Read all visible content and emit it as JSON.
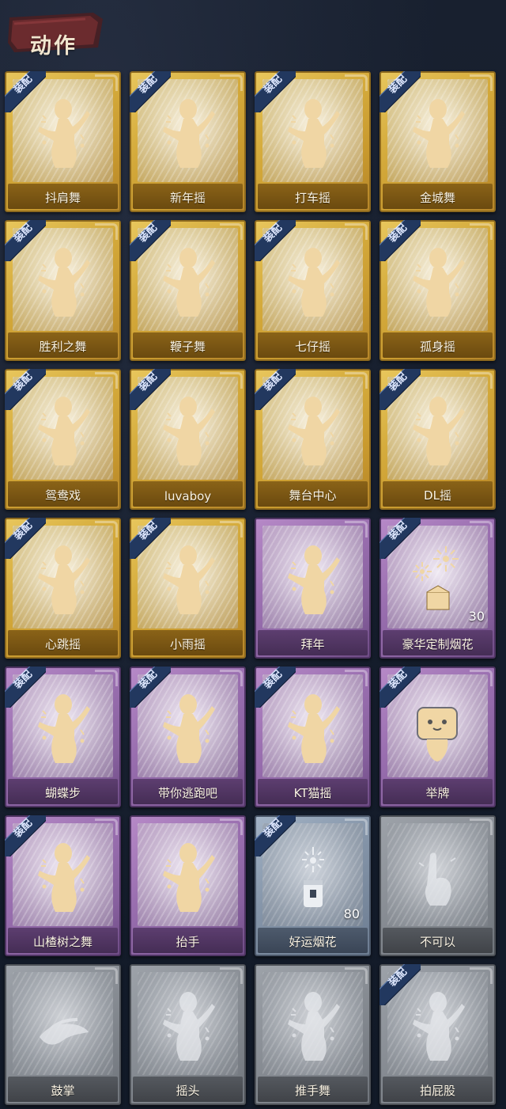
{
  "header": {
    "title": "动作"
  },
  "equip_label": "装配",
  "items": [
    {
      "name": "抖肩舞",
      "tier": "gold",
      "equipped": true,
      "icon": "dance-figure-icon"
    },
    {
      "name": "新年摇",
      "tier": "gold",
      "equipped": true,
      "icon": "dance-figure-icon"
    },
    {
      "name": "打车摇",
      "tier": "gold",
      "equipped": true,
      "icon": "dance-figure-icon"
    },
    {
      "name": "金城舞",
      "tier": "gold",
      "equipped": true,
      "icon": "dance-figure-icon"
    },
    {
      "name": "胜利之舞",
      "tier": "gold",
      "equipped": true,
      "icon": "dance-figure-icon"
    },
    {
      "name": "鞭子舞",
      "tier": "gold",
      "equipped": true,
      "icon": "dance-figure-icon"
    },
    {
      "name": "七仔摇",
      "tier": "gold",
      "equipped": true,
      "icon": "dance-figure-icon"
    },
    {
      "name": "孤身摇",
      "tier": "gold",
      "equipped": true,
      "icon": "dance-figure-icon"
    },
    {
      "name": "鸳鸯戏",
      "tier": "gold",
      "equipped": true,
      "icon": "dance-figure-icon"
    },
    {
      "name": "luvaboy",
      "tier": "gold",
      "equipped": true,
      "icon": "dance-figure-icon"
    },
    {
      "name": "舞台中心",
      "tier": "gold",
      "equipped": true,
      "icon": "dance-figure-icon"
    },
    {
      "name": "DL摇",
      "tier": "gold",
      "equipped": true,
      "icon": "dance-figure-icon"
    },
    {
      "name": "心跳摇",
      "tier": "gold",
      "equipped": true,
      "icon": "dance-figure-icon"
    },
    {
      "name": "小雨摇",
      "tier": "gold",
      "equipped": true,
      "icon": "dance-figure-icon"
    },
    {
      "name": "拜年",
      "tier": "purple",
      "equipped": false,
      "icon": "bow-figure-icon"
    },
    {
      "name": "豪华定制烟花",
      "tier": "purple",
      "equipped": true,
      "icon": "fireworks-box-icon",
      "count": "30"
    },
    {
      "name": "蝴蝶步",
      "tier": "purple",
      "equipped": true,
      "icon": "dance-figure-icon"
    },
    {
      "name": "带你逃跑吧",
      "tier": "purple",
      "equipped": true,
      "icon": "dance-figure-icon"
    },
    {
      "name": "KT猫摇",
      "tier": "purple",
      "equipped": true,
      "icon": "dance-figure-icon"
    },
    {
      "name": "举牌",
      "tier": "purple",
      "equipped": true,
      "icon": "sign-figure-icon"
    },
    {
      "name": "山楂树之舞",
      "tier": "purple",
      "equipped": true,
      "icon": "dance-figure-icon"
    },
    {
      "name": "抬手",
      "tier": "purple",
      "equipped": false,
      "icon": "raise-hand-figure-icon"
    },
    {
      "name": "好运烟花",
      "tier": "blue",
      "equipped": true,
      "icon": "firecracker-icon",
      "count": "80"
    },
    {
      "name": "不可以",
      "tier": "gray",
      "equipped": false,
      "icon": "finger-wag-icon"
    },
    {
      "name": "鼓掌",
      "tier": "gray",
      "equipped": false,
      "icon": "clap-hands-icon"
    },
    {
      "name": "摇头",
      "tier": "gray",
      "equipped": false,
      "icon": "shake-head-figure-icon"
    },
    {
      "name": "推手舞",
      "tier": "gray",
      "equipped": false,
      "icon": "push-hands-figure-icon"
    },
    {
      "name": "拍屁股",
      "tier": "gray",
      "equipped": true,
      "icon": "pat-figure-icon"
    }
  ],
  "colors": {
    "gold": "#d6ad3e",
    "purple": "#9a6fb0",
    "blue": "#8494a8",
    "gray": "#888d94",
    "equip_band": "#22385f",
    "figure_gold": "#f0d6a4"
  }
}
